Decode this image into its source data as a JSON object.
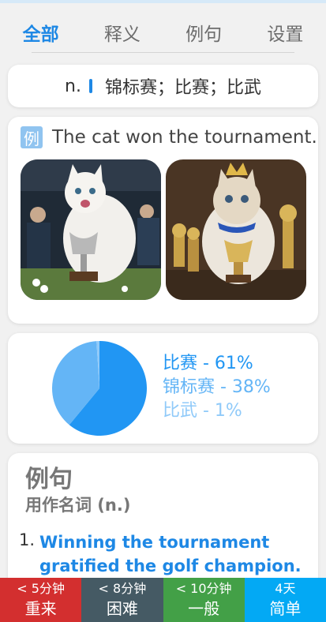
{
  "tabs": [
    {
      "label": "全部"
    },
    {
      "label": "释义"
    },
    {
      "label": "例句"
    },
    {
      "label": "设置"
    }
  ],
  "definition": {
    "pos": "n.",
    "meaning": "锦标赛；比赛；比武"
  },
  "example": {
    "badge": "例",
    "sentence": "The cat won the tournament."
  },
  "pie": {
    "legend": [
      {
        "text": "比赛 - 61%",
        "color": "#2196f3"
      },
      {
        "text": "锦标赛 - 38%",
        "color": "#64b5f6"
      },
      {
        "text": "比武 - 1%",
        "color": "#90caf9"
      }
    ]
  },
  "chart_data": {
    "type": "pie",
    "categories": [
      "比赛",
      "锦标赛",
      "比武"
    ],
    "values": [
      61,
      38,
      1
    ],
    "colors": [
      "#2196f3",
      "#64b5f6",
      "#90caf9"
    ]
  },
  "sentences": {
    "title": "例句",
    "subtitle": "用作名词 (n.)",
    "items": [
      {
        "num": "1.",
        "text": "Winning the tournament gratified the golf champion."
      }
    ]
  },
  "bottom": [
    {
      "time": "< 5分钟",
      "label": "重来",
      "color": "#d32f2f"
    },
    {
      "time": "< 8分钟",
      "label": "困难",
      "color": "#455a64"
    },
    {
      "time": "< 10分钟",
      "label": "一般",
      "color": "#43a047"
    },
    {
      "time": "4天",
      "label": "简单",
      "color": "#03a9f4"
    }
  ]
}
